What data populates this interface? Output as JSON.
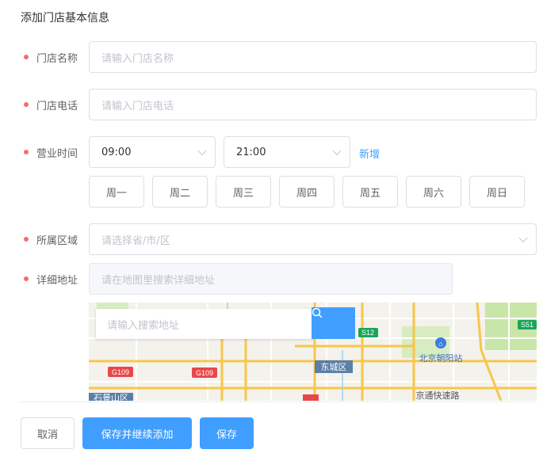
{
  "form": {
    "title": "添加门店基本信息",
    "store_name": {
      "label": "门店名称",
      "placeholder": "请输入门店名称",
      "value": ""
    },
    "store_phone": {
      "label": "门店电话",
      "placeholder": "请输入门店电话",
      "value": ""
    },
    "business_hours": {
      "label": "营业时间",
      "start": "09:00",
      "end": "21:00",
      "add_label": "新增",
      "weekdays": [
        "周一",
        "周二",
        "周三",
        "周四",
        "周五",
        "周六",
        "周日"
      ]
    },
    "region": {
      "label": "所属区域",
      "placeholder": "请选择省/市/区"
    },
    "address": {
      "label": "详细地址",
      "placeholder": "请在地图里搜索详细地址"
    }
  },
  "map": {
    "search_placeholder": "请输入搜索地址",
    "labels": {
      "road_s12": "S12",
      "road_s51": "S51",
      "road_g109_a": "G109",
      "road_g109_b": "G109",
      "district_dongcheng": "东城区",
      "station": "北京朝阳站",
      "expressway": "京通快速路",
      "district_shijingshan": "石景山区"
    },
    "colors": {
      "road_major": "#f7c64a",
      "road_minor": "#ffffff",
      "base": "#f4f2ec",
      "green": "#c8e6a8"
    }
  },
  "actions": {
    "cancel": "取消",
    "save_continue": "保存并继续添加",
    "save": "保存"
  },
  "colors": {
    "primary": "#409eff",
    "required": "#f56c6c",
    "border": "#dcdfe6"
  }
}
